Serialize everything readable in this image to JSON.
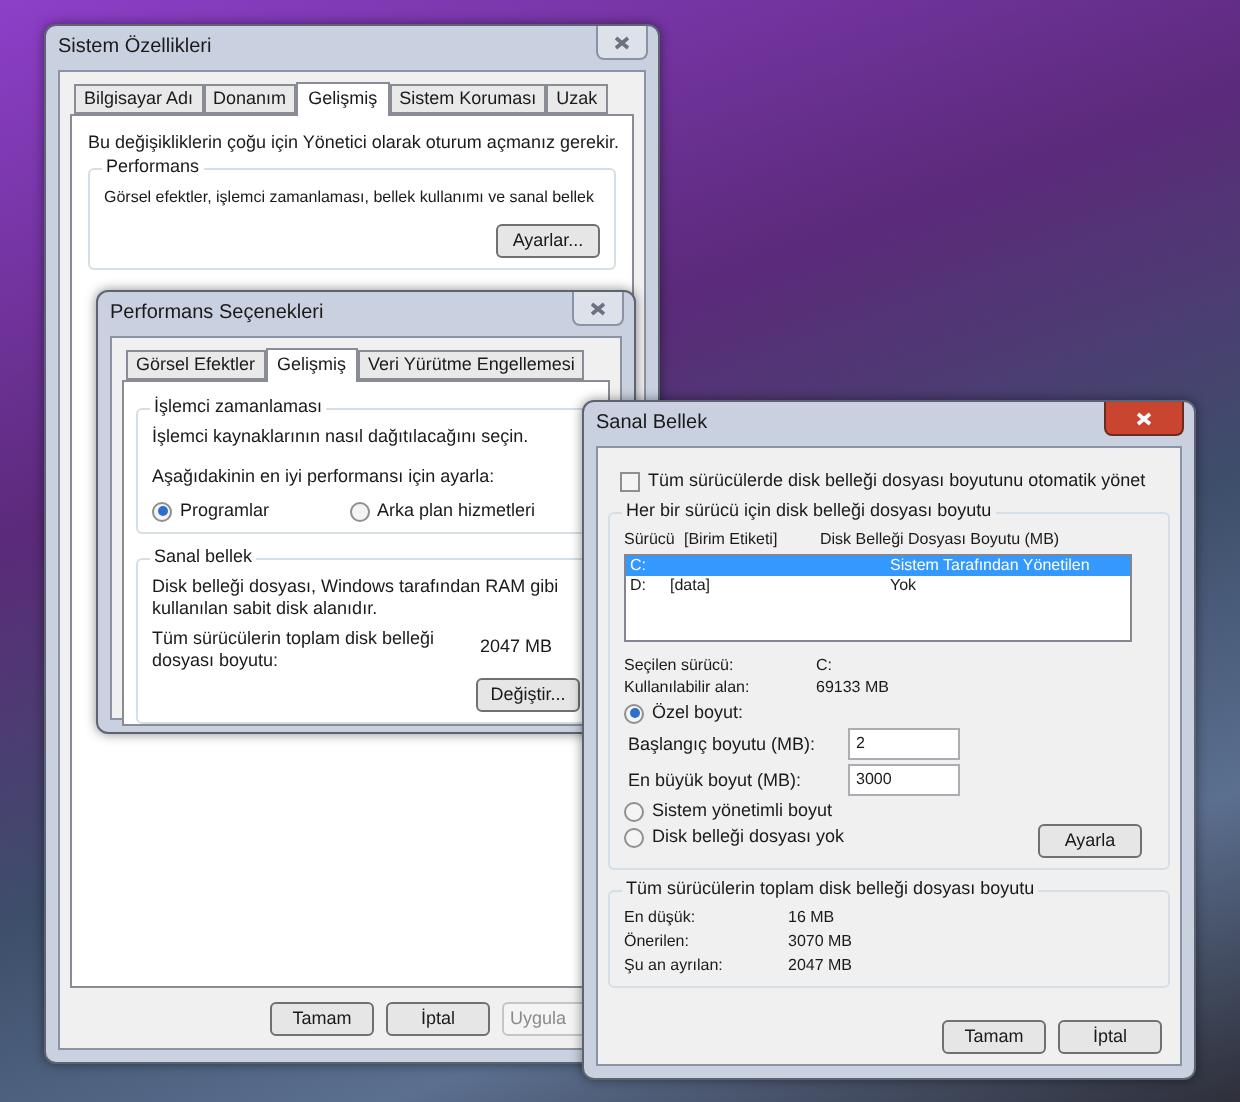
{
  "system_properties": {
    "title": "Sistem Özellikleri",
    "active": false,
    "tabs": [
      {
        "label": "Bilgisayar Adı",
        "selected": false
      },
      {
        "label": "Donanım",
        "selected": false
      },
      {
        "label": "Gelişmiş",
        "selected": true
      },
      {
        "label": "Sistem Koruması",
        "selected": false
      },
      {
        "label": "Uzak",
        "selected": false
      }
    ],
    "notice": "Bu değişikliklerin çoğu için Yönetici olarak oturum açmanız gerekir.",
    "performance_group": {
      "label": "Performans",
      "description": "Görsel efektler, işlemci zamanlaması, bellek kullanımı ve sanal bellek",
      "button": "Ayarlar..."
    },
    "buttons": [
      {
        "label": "Tamam",
        "disabled": false
      },
      {
        "label": "İptal",
        "disabled": false
      },
      {
        "label": "Uygula",
        "disabled": true
      }
    ]
  },
  "performance_options": {
    "title": "Performans Seçenekleri",
    "active": false,
    "tabs": [
      {
        "label": "Görsel Efektler",
        "selected": false
      },
      {
        "label": "Gelişmiş",
        "selected": true
      },
      {
        "label": "Veri Yürütme Engellemesi",
        "selected": false
      }
    ],
    "processor_group": {
      "label": "İşlemci zamanlaması",
      "description": "İşlemci kaynaklarının nasıl dağıtılacağını seçin.",
      "prompt": "Aşağıdakinin en iyi performansı için ayarla:",
      "options": [
        {
          "label": "Programlar",
          "selected": true
        },
        {
          "label": "Arka plan hizmetleri",
          "selected": false
        }
      ]
    },
    "virtual_memory_group": {
      "label": "Sanal bellek",
      "description": "Disk belleği dosyası, Windows tarafından RAM gibi kullanılan sabit disk alanıdır.",
      "total_label": "Tüm sürücülerin toplam disk belleği dosyası boyutu:",
      "total_value": "2047 MB",
      "button": "Değiştir..."
    }
  },
  "virtual_memory": {
    "title": "Sanal Bellek",
    "active": true,
    "auto_manage": {
      "label": "Tüm sürücülerde disk belleği dosyası boyutunu otomatik yönet",
      "checked": false
    },
    "drives_group": {
      "label": "Her bir sürücü için disk belleği dosyası boyutu",
      "columns": [
        "Sürücü",
        "[Birim Etiketi]",
        "Disk Belleği Dosyası Boyutu (MB)"
      ],
      "rows": [
        {
          "drive": "C:",
          "paging_file": "Sistem Tarafından Yönetilen",
          "selected": true
        },
        {
          "drive": "D:",
          "volume_label": "[data]",
          "paging_file": "Yok",
          "selected": false
        }
      ],
      "selected_drive_label": "Seçilen sürücü:",
      "selected_drive": "C:",
      "free_space_label": "Kullanılabilir alan:",
      "free_space": "69133 MB",
      "options": [
        {
          "kind": "custom",
          "label": "Özel boyut:",
          "selected": true
        },
        {
          "kind": "plain",
          "label": "Sistem yönetimli boyut",
          "selected": false
        },
        {
          "kind": "plain",
          "label": "Disk belleği dosyası yok",
          "selected": false
        }
      ],
      "fields": [
        {
          "label": "Başlangıç boyutu (MB):",
          "value": "2"
        },
        {
          "label": "En büyük boyut (MB):",
          "value": "3000"
        }
      ],
      "set_button": "Ayarla"
    },
    "totals_group": {
      "label": "Tüm sürücülerin toplam disk belleği dosyası boyutu",
      "rows": [
        {
          "label": "En düşük:",
          "value": "16 MB"
        },
        {
          "label": "Önerilen:",
          "value": "3070 MB"
        },
        {
          "label": "Şu an ayrılan:",
          "value": "2047 MB"
        }
      ]
    },
    "buttons": [
      "Tamam",
      "İptal"
    ]
  }
}
